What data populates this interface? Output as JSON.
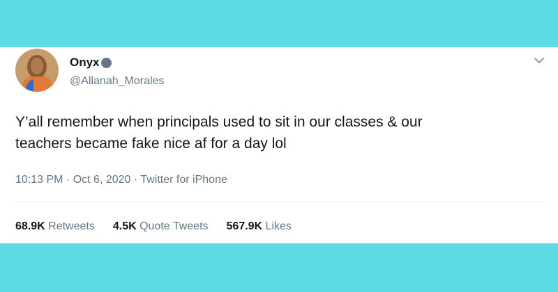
{
  "colors": {
    "background": "#5ddde3",
    "card": "#ffffff",
    "text": "#14171a",
    "muted": "#657786"
  },
  "tweet": {
    "display_name": "Onyx",
    "handle": "@Allanah_Morales",
    "text_line1": "Y’all remember when principals used to sit in our classes & our",
    "text_line2": "teachers became fake nice af for a day lol",
    "time": "10:13 PM",
    "separator": " · ",
    "date": "Oct 6, 2020",
    "source": "Twitter for iPhone",
    "stats": {
      "retweets_count": "68.9K",
      "retweets_label": " Retweets",
      "quotes_count": "4.5K",
      "quotes_label": " Quote Tweets",
      "likes_count": "567.9K",
      "likes_label": " Likes"
    },
    "icons": {
      "badge": "verified-badge-icon",
      "menu": "chevron-down-icon"
    }
  }
}
